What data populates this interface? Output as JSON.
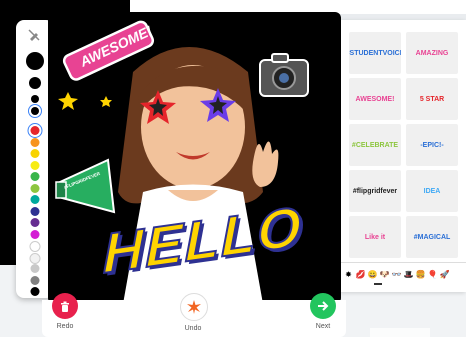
{
  "canvas_stickers": {
    "awesome": "AWESOME!",
    "hello": "HELLO",
    "hashtag": "#FLIPGRIDFEVER"
  },
  "tools": {
    "pen_sizes": [
      "large",
      "medium",
      "small",
      "tiny"
    ],
    "colors": [
      "#e5252b",
      "#f7941d",
      "#f8d300",
      "#f7ec13",
      "#39b54a",
      "#8dc63f",
      "#00a99d",
      "#2e3192",
      "#662d91",
      "#d41ed4",
      "#ffffff",
      "#f2f2f2",
      "#c8c8c8",
      "#808080",
      "#000000"
    ],
    "selected_color": "#e5252b"
  },
  "sticker_panel": {
    "stickers": [
      {
        "text": "#STUDENTVOICE",
        "color": "#2a6fd6"
      },
      {
        "text": "AMAZING",
        "color": "#e84393"
      },
      {
        "text": "AWESOME!",
        "color": "#e84393"
      },
      {
        "text": "5 STAR",
        "color": "#e5252b"
      },
      {
        "text": "#CELEBRATE",
        "color": "#8dc63f"
      },
      {
        "text": "-EPIC!-",
        "color": "#2a6fd6"
      },
      {
        "text": "#flipgridfever",
        "color": "#222222"
      },
      {
        "text": "IDEA",
        "color": "#3fa9f5"
      },
      {
        "text": "Like it",
        "color": "#e84393"
      },
      {
        "text": "#MAGICAL",
        "color": "#2a6fd6"
      }
    ],
    "emoji_tabs": [
      "✸",
      "💋",
      "😀",
      "🐶",
      "👓",
      "🎩",
      "🍔",
      "🎈",
      "🚀"
    ]
  },
  "bottom_bar": {
    "redo_label": "Redo",
    "undo_label": "Undo",
    "next_label": "Next"
  },
  "colors": {
    "redo": "#e8214d",
    "next": "#22c55e",
    "undo": "#f26522"
  }
}
